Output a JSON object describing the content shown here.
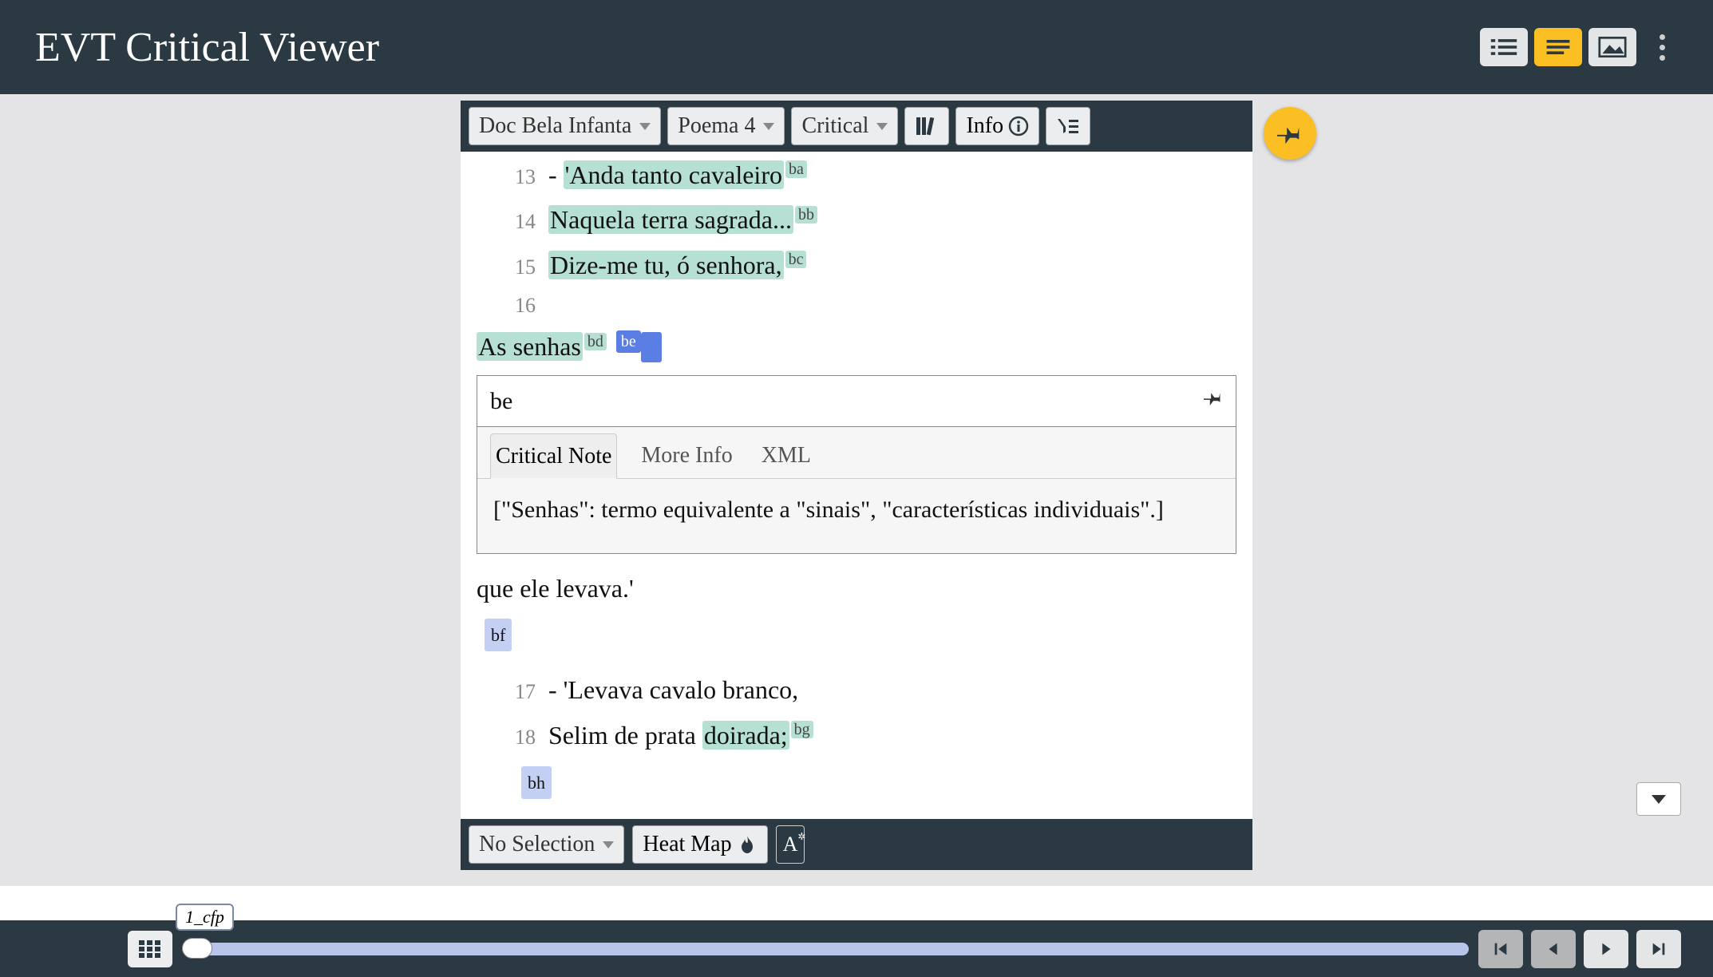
{
  "header": {
    "title": "EVT Critical Viewer"
  },
  "toolbar": {
    "doc_selector": "Doc Bela Infanta",
    "poem_selector": "Poema 4",
    "edition_selector": "Critical",
    "info_label": "Info"
  },
  "lines": {
    "l13": {
      "num": "13",
      "prefix": "- ",
      "text": "'Anda tanto cavaleiro",
      "sup": "ba"
    },
    "l14": {
      "num": "14",
      "text": "Naquela terra sagrada...",
      "sup": "bb"
    },
    "l15": {
      "num": "15",
      "text": "Dize-me tu, ó senhora,",
      "sup": "bc"
    },
    "l16": {
      "num": "16"
    },
    "as_senhas": {
      "text": "As senhas",
      "sup1": "bd",
      "sup2": "be"
    },
    "after_note": "que ele levava.'",
    "bf_tag": "bf",
    "l17": {
      "num": "17",
      "prefix": "- '",
      "text": "Levava cavalo branco,"
    },
    "l18": {
      "num": "18",
      "t1": "Selim de prata ",
      "t2": "doirada;",
      "sup": "bg"
    },
    "bh_tag": "bh"
  },
  "note": {
    "title": "be",
    "tabs": {
      "critical": "Critical Note",
      "more": "More Info",
      "xml": "XML"
    },
    "body": "[\"Senhas\": termo equivalente a \"sinais\", \"características individuais\".]"
  },
  "bottom": {
    "selection": "No Selection",
    "heatmap": "Heat Map"
  },
  "footer": {
    "slider_label": "1_cfp"
  }
}
